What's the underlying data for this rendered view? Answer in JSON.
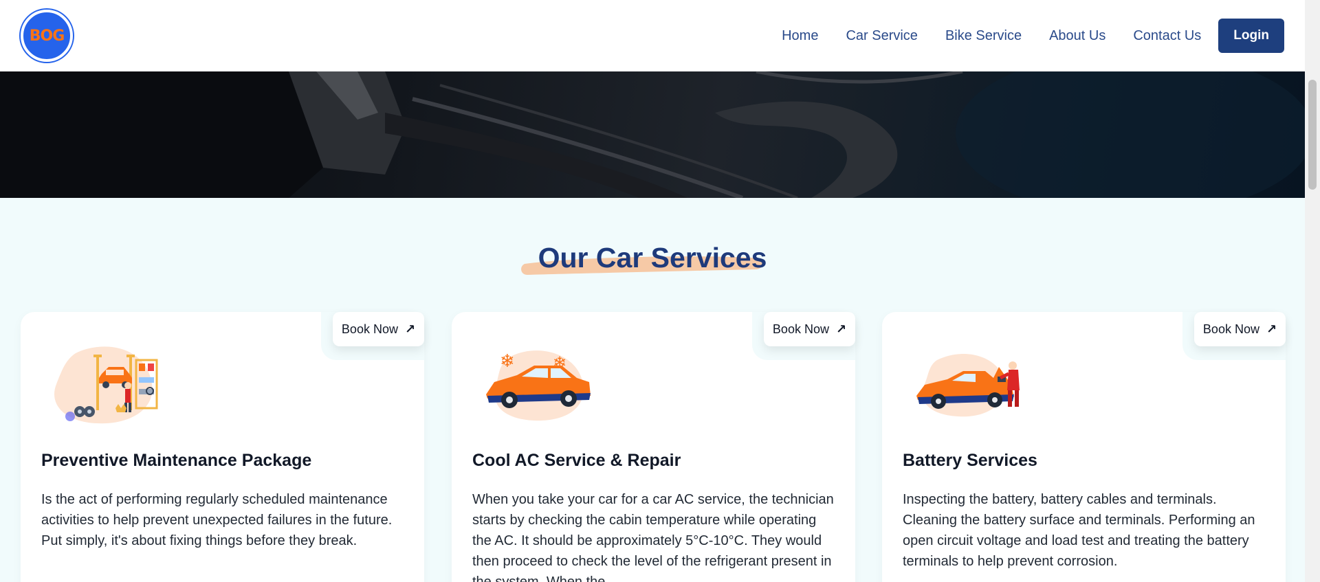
{
  "header": {
    "logo_text": "BOG",
    "nav": [
      "Home",
      "Car Service",
      "Bike Service",
      "About Us",
      "Contact Us"
    ],
    "login_label": "Login"
  },
  "section": {
    "title": "Our Car Services"
  },
  "cards": [
    {
      "book_label": "Book Now",
      "title": "Preventive Maintenance Package",
      "description": "Is the act of performing regularly scheduled maintenance activities to help prevent unexpected failures in the future. Put simply, it's about fixing things before they break."
    },
    {
      "book_label": "Book Now",
      "title": "Cool AC Service & Repair",
      "description": "When you take your car for a car AC service, the technician starts by checking the cabin temperature while operating the AC. It should be approximately 5°C-10°C. They would then proceed to check the level of the refrigerant present in the system. When the"
    },
    {
      "book_label": "Book Now",
      "title": "Battery Services",
      "description": "Inspecting the battery, battery cables and terminals. Cleaning the battery surface and terminals. Performing an open circuit voltage and load test and treating the battery terminals to help prevent corrosion."
    }
  ],
  "colors": {
    "primary": "#1e3f7e",
    "title": "#1e3a7b",
    "accent": "#f97316",
    "highlight": "#f6c9a6",
    "background": "#f1fbfc"
  },
  "icons": {
    "book_arrow": "arrow-up-right-icon",
    "logo": "bog-logo-icon"
  }
}
